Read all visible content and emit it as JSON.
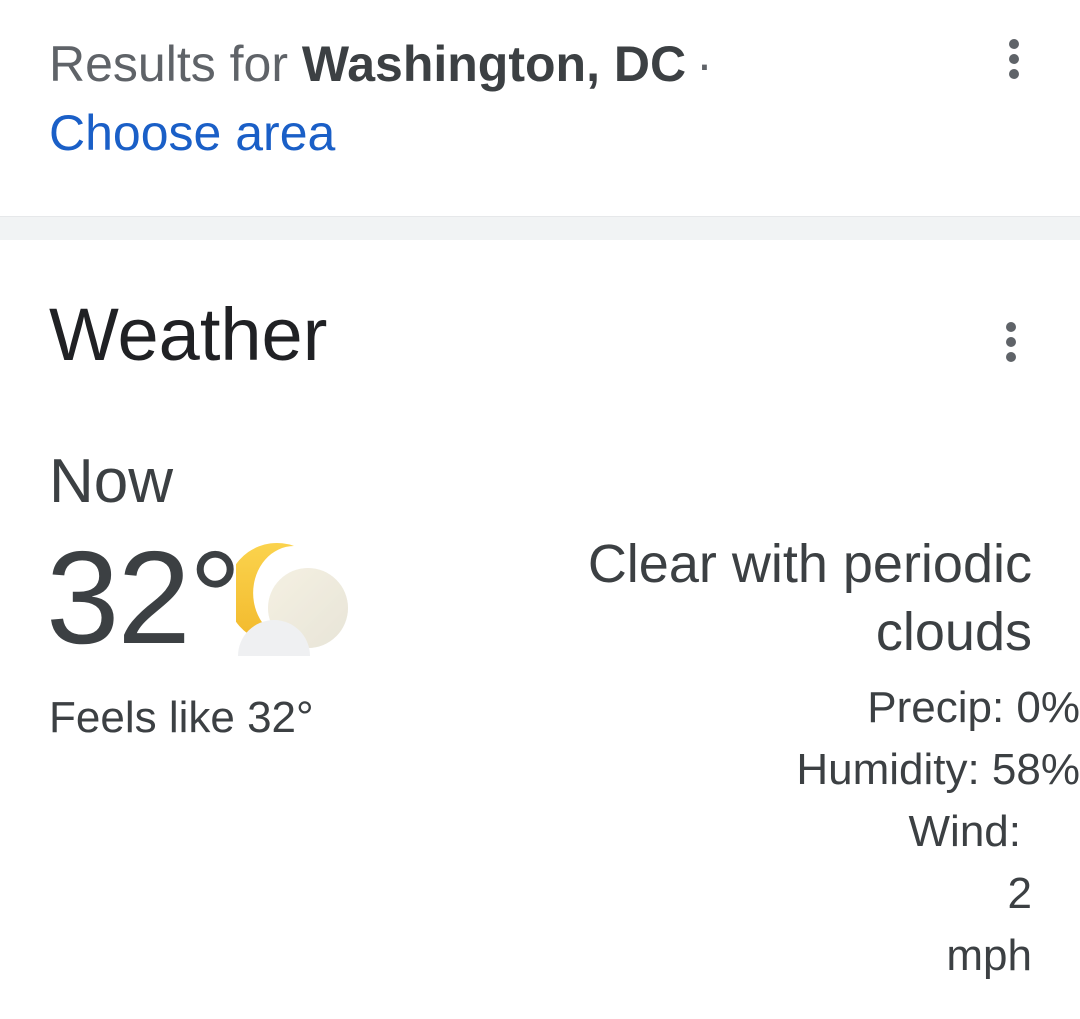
{
  "header": {
    "results_prefix": "Results for",
    "location": "Washington, DC",
    "separator_dot": "·",
    "choose_area": "Choose area"
  },
  "weather": {
    "title": "Weather",
    "now_label": "Now",
    "temperature": "32°",
    "icon": "moon-with-clouds-icon",
    "feels_like": "Feels like 32°",
    "condition": "Clear with periodic clouds",
    "precip": "Precip: 0%",
    "humidity": "Humidity: 58%",
    "wind_label": "Wind:",
    "wind_value": "2",
    "wind_unit": "mph"
  },
  "colors": {
    "link": "#1a5fc7",
    "text_primary": "#202124",
    "text_secondary": "#3c4043",
    "text_muted": "#5f6368",
    "separator": "#f1f3f4",
    "moon": "#f6c53b",
    "cloud": "#e8eaed"
  }
}
